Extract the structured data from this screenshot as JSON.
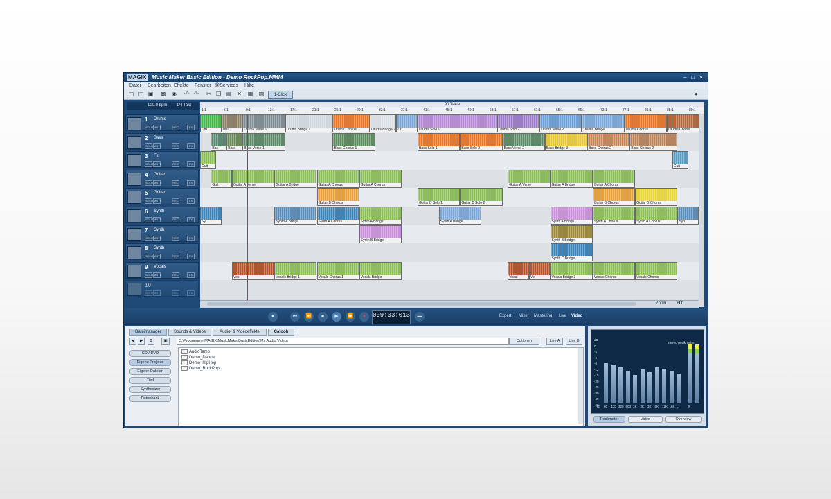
{
  "app": {
    "logo": "MAGIX",
    "title": "Music Maker Basic Edition -  Demo RockPop.MMM"
  },
  "menu": [
    "Datei",
    "Bearbeiten",
    "Effekte",
    "Fenster",
    "@Services",
    "Hilfe"
  ],
  "toolbar": {
    "one_click": "1-Click"
  },
  "tempo": {
    "bpm": "100.0 bpm",
    "meter": "1/4 Takt"
  },
  "tracks": [
    {
      "num": "1",
      "name": "Drums",
      "icon": "drum-icon"
    },
    {
      "num": "2",
      "name": "Bass",
      "icon": "bass-guitar-icon"
    },
    {
      "num": "3",
      "name": "Fx",
      "icon": "fx-icon"
    },
    {
      "num": "4",
      "name": "Guitar",
      "icon": "guitar-icon"
    },
    {
      "num": "5",
      "name": "Guitar",
      "icon": "guitar-icon"
    },
    {
      "num": "6",
      "name": "Synth",
      "icon": "keyboard-icon"
    },
    {
      "num": "7",
      "name": "Synth",
      "icon": "keyboard-icon"
    },
    {
      "num": "8",
      "name": "Synth",
      "icon": "keyboard-icon"
    },
    {
      "num": "9",
      "name": "Vocals",
      "icon": "microphone-icon"
    },
    {
      "num": "10",
      "name": "",
      "icon": ""
    }
  ],
  "track_buttons": {
    "solo": "SOLO",
    "mute": "MUTE",
    "rec": "REC",
    "fx": "FX"
  },
  "arrange": {
    "info": "90 Takte",
    "ruler": [
      "1:1",
      "5:1",
      "9:1",
      "13:1",
      "17:1",
      "21:1",
      "25:1",
      "29:1",
      "33:1",
      "37:1",
      "41:1",
      "45:1",
      "49:1",
      "53:1",
      "57:1",
      "61:1",
      "65:1",
      "69:1",
      "73:1",
      "77:1",
      "81:1",
      "85:1",
      "89:1"
    ],
    "zoom": "Zoom",
    "fit": "FIT",
    "objects": [
      {
        "lane": 0,
        "start": 0,
        "len": 16,
        "color": "#47b84a",
        "label": "Dru"
      },
      {
        "lane": 0,
        "start": 16,
        "len": 16,
        "color": "#8d8066",
        "label": "Dru"
      },
      {
        "lane": 0,
        "start": 32,
        "len": 32,
        "color": "#7e8d93",
        "label": "Drums Verse 1"
      },
      {
        "lane": 0,
        "start": 64,
        "len": 36,
        "color": "#cfd6dd",
        "label": "Drums Bridge 1"
      },
      {
        "lane": 0,
        "start": 100,
        "len": 28,
        "color": "#e8772a",
        "label": "Drums Chorus"
      },
      {
        "lane": 0,
        "start": 128,
        "len": 20,
        "color": "#d9dee4",
        "label": "Drums Bridge 2"
      },
      {
        "lane": 0,
        "start": 148,
        "len": 16,
        "color": "#7ba6d6",
        "label": "Dr"
      },
      {
        "lane": 0,
        "start": 164,
        "len": 60,
        "color": "#b58ad6",
        "label": "Drums Solo 1"
      },
      {
        "lane": 0,
        "start": 224,
        "len": 32,
        "color": "#9c7bc9",
        "label": "Drums Solo 2"
      },
      {
        "lane": 0,
        "start": 256,
        "len": 32,
        "color": "#6ea0d8",
        "label": "Drums Verse 2"
      },
      {
        "lane": 0,
        "start": 288,
        "len": 32,
        "color": "#7aa8da",
        "label": "Drums Bridge"
      },
      {
        "lane": 0,
        "start": 320,
        "len": 32,
        "color": "#e8772a",
        "label": "Drums Chorus"
      },
      {
        "lane": 0,
        "start": 352,
        "len": 32,
        "color": "#b0693a",
        "label": "Drums Chorus"
      },
      {
        "lane": 1,
        "start": 8,
        "len": 12,
        "color": "#5b8a74",
        "label": "Bas"
      },
      {
        "lane": 1,
        "start": 20,
        "len": 12,
        "color": "#6b8a5c",
        "label": "Bass"
      },
      {
        "lane": 1,
        "start": 32,
        "len": 32,
        "color": "#5f8a6a",
        "label": "Bass Verse 1"
      },
      {
        "lane": 1,
        "start": 100,
        "len": 32,
        "color": "#5d8a5e",
        "label": "Bass Chorus 1"
      },
      {
        "lane": 1,
        "start": 164,
        "len": 32,
        "color": "#e8772a",
        "label": "Bass Solo 1"
      },
      {
        "lane": 1,
        "start": 196,
        "len": 32,
        "color": "#e8772a",
        "label": "Bass Solo 2"
      },
      {
        "lane": 1,
        "start": 228,
        "len": 32,
        "color": "#5f8a6a",
        "label": "Bass Verse 2"
      },
      {
        "lane": 1,
        "start": 260,
        "len": 32,
        "color": "#e6c63a",
        "label": "Bass Bridge 3"
      },
      {
        "lane": 1,
        "start": 292,
        "len": 32,
        "color": "#c7865a",
        "label": "Bass Chorus 2"
      },
      {
        "lane": 1,
        "start": 324,
        "len": 36,
        "color": "#b9845c",
        "label": "Bass Chorus 2"
      },
      {
        "lane": 2,
        "start": 0,
        "len": 12,
        "color": "#8cbf5a",
        "label": "Guit"
      },
      {
        "lane": 2,
        "start": 356,
        "len": 12,
        "color": "#5a9ec4",
        "label": "Guit"
      },
      {
        "lane": 3,
        "start": 8,
        "len": 16,
        "color": "#8cbf5a",
        "label": "Guit"
      },
      {
        "lane": 3,
        "start": 24,
        "len": 32,
        "color": "#8cbf5a",
        "label": "Guitar A Verse"
      },
      {
        "lane": 3,
        "start": 56,
        "len": 32,
        "color": "#8cbf5a",
        "label": "Guitar A Bridge"
      },
      {
        "lane": 3,
        "start": 88,
        "len": 32,
        "color": "#8cbf5a",
        "label": "Guitar A Chorus"
      },
      {
        "lane": 3,
        "start": 120,
        "len": 32,
        "color": "#8cbf5a",
        "label": "Guitar A Chorus"
      },
      {
        "lane": 3,
        "start": 232,
        "len": 32,
        "color": "#8cbf5a",
        "label": "Guitar A Verse"
      },
      {
        "lane": 3,
        "start": 264,
        "len": 32,
        "color": "#8cbf5a",
        "label": "Guitar A Bridge"
      },
      {
        "lane": 3,
        "start": 296,
        "len": 32,
        "color": "#8cbf5a",
        "label": "Guitar A Chorus"
      },
      {
        "lane": 4,
        "start": 88,
        "len": 32,
        "color": "#e8a03a",
        "label": "Guitar B Chorus"
      },
      {
        "lane": 4,
        "start": 164,
        "len": 32,
        "color": "#8cbf5a",
        "label": "Guitar B Solo 1"
      },
      {
        "lane": 4,
        "start": 196,
        "len": 32,
        "color": "#8cbf5a",
        "label": "Guitar B Solo 2"
      },
      {
        "lane": 4,
        "start": 296,
        "len": 32,
        "color": "#e8a03a",
        "label": "Guitar B Chorus"
      },
      {
        "lane": 4,
        "start": 328,
        "len": 32,
        "color": "#e6d63a",
        "label": "Guitar B Chorus"
      },
      {
        "lane": 5,
        "start": 0,
        "len": 16,
        "color": "#3d84b8",
        "label": "Sy"
      },
      {
        "lane": 5,
        "start": 56,
        "len": 32,
        "color": "#5b8dbb",
        "label": "Synth A Bridge"
      },
      {
        "lane": 5,
        "start": 88,
        "len": 32,
        "color": "#3d84b8",
        "label": "Synth A Chorus"
      },
      {
        "lane": 5,
        "start": 120,
        "len": 32,
        "color": "#8cbf5a",
        "label": "Synth A Bridge"
      },
      {
        "lane": 5,
        "start": 180,
        "len": 32,
        "color": "#7ba6d6",
        "label": "Synth A Bridge"
      },
      {
        "lane": 5,
        "start": 264,
        "len": 32,
        "color": "#c98fd8",
        "label": "Synth A Bridge"
      },
      {
        "lane": 5,
        "start": 296,
        "len": 32,
        "color": "#8cbf5a",
        "label": "Synth A Chorus"
      },
      {
        "lane": 5,
        "start": 328,
        "len": 32,
        "color": "#8cbf5a",
        "label": "Synth A Chorus"
      },
      {
        "lane": 5,
        "start": 360,
        "len": 16,
        "color": "#5b8dbb",
        "label": "Syn"
      },
      {
        "lane": 6,
        "start": 120,
        "len": 32,
        "color": "#c98fd8",
        "label": "Synth B Bridge"
      },
      {
        "lane": 6,
        "start": 264,
        "len": 32,
        "color": "#9c8a3a",
        "label": "Synth B Bridge"
      },
      {
        "lane": 7,
        "start": 264,
        "len": 32,
        "color": "#3d84b8",
        "label": "Synth C Bridge"
      },
      {
        "lane": 8,
        "start": 24,
        "len": 32,
        "color": "#b5532a",
        "label": "Voc"
      },
      {
        "lane": 8,
        "start": 56,
        "len": 32,
        "color": "#8cbf5a",
        "label": "Vocals Bridge 1"
      },
      {
        "lane": 8,
        "start": 88,
        "len": 32,
        "color": "#8cbf5a",
        "label": "Vocals Chorus 1"
      },
      {
        "lane": 8,
        "start": 120,
        "len": 32,
        "color": "#8cbf5a",
        "label": "Vocals Bridge"
      },
      {
        "lane": 8,
        "start": 232,
        "len": 16,
        "color": "#b5532a",
        "label": "Vocal"
      },
      {
        "lane": 8,
        "start": 248,
        "len": 16,
        "color": "#b5532a",
        "label": "Vo"
      },
      {
        "lane": 8,
        "start": 264,
        "len": 32,
        "color": "#8cbf5a",
        "label": "Vocals Bridge 3"
      },
      {
        "lane": 8,
        "start": 296,
        "len": 32,
        "color": "#8cbf5a",
        "label": "Vocals Chorus"
      },
      {
        "lane": 8,
        "start": 328,
        "len": 32,
        "color": "#8cbf5a",
        "label": "Vocals Chorus"
      }
    ]
  },
  "transport": {
    "time": "009:03:013",
    "tabs": [
      "Expert",
      "Mixer",
      "Mastering",
      "Live",
      "Video"
    ]
  },
  "filemanager": {
    "tabs": [
      "Dateimanager",
      "Sounds & Videos",
      "Audio- & Videoeffekte",
      "Catooh"
    ],
    "path": "C:\\Programme\\MAGIX\\MusicMakerBasicEdition\\My Audio Video\\",
    "optionen": "Optionen",
    "live_a": "Live A",
    "live_b": "Live B",
    "side_buttons": [
      "CD / DVD",
      "Eigene Projekte",
      "Eigene Dateien",
      "Titel",
      "Synthesizer",
      "Datenbank"
    ],
    "files": [
      "AudioTemp",
      "Demo_Dance",
      "Demo_HipHop",
      "Demo_RockPop"
    ]
  },
  "peakmeter": {
    "label": "stereo peakmeter",
    "tabs": [
      "Peakmeter",
      "Video",
      "Overview"
    ],
    "db_scale": [
      "dB",
      "0",
      "-3",
      "-6",
      "-9",
      "-12",
      "-15",
      "-20",
      "-25",
      "-30",
      "-40",
      "-60"
    ],
    "freq": [
      "HZ",
      "60",
      "120",
      "320",
      "800",
      "1K",
      "2K",
      "3K",
      "5K",
      "12K",
      "16K",
      "L",
      "R"
    ],
    "levels": [
      0.62,
      0.6,
      0.55,
      0.5,
      0.44,
      0.52,
      0.48,
      0.55,
      0.53,
      0.5,
      0.46,
      0.92,
      0.9
    ]
  }
}
